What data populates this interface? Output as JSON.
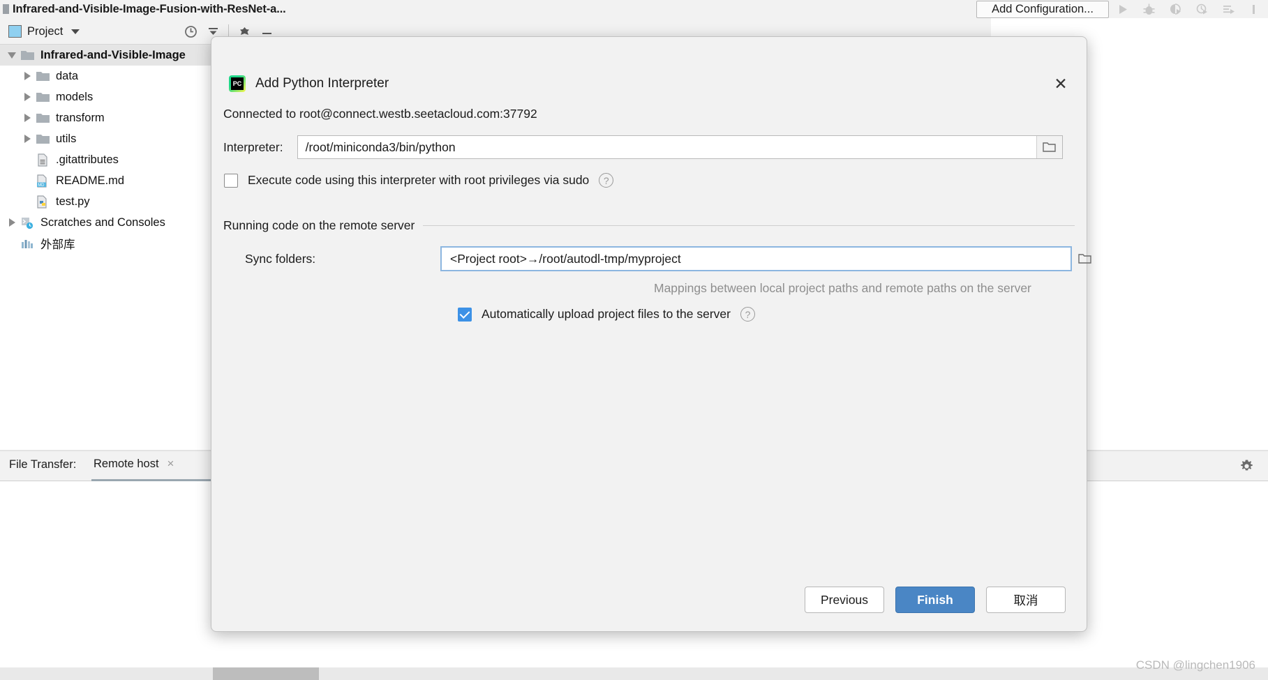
{
  "titlebar": {
    "project_title": "Infrared-and-Visible-Image-Fusion-with-ResNet-a...",
    "add_configuration_label": "Add Configuration...",
    "icons": [
      "run-icon",
      "debug-icon",
      "coverage-icon",
      "profile-icon",
      "services-icon"
    ]
  },
  "project_panel": {
    "header_label": "Project",
    "header_icons": [
      "locate-icon",
      "collapse-all-icon",
      "settings-icon",
      "hide-icon"
    ],
    "tree": [
      {
        "label": "Infrared-and-Visible-Image",
        "icon": "folder-icon",
        "arrow": "d",
        "selected": true,
        "indent": 1
      },
      {
        "label": "data",
        "icon": "folder-icon",
        "arrow": "r",
        "selected": false,
        "indent": 2
      },
      {
        "label": "models",
        "icon": "folder-icon",
        "arrow": "r",
        "selected": false,
        "indent": 2
      },
      {
        "label": "transform",
        "icon": "folder-icon",
        "arrow": "r",
        "selected": false,
        "indent": 2
      },
      {
        "label": "utils",
        "icon": "folder-icon",
        "arrow": "r",
        "selected": false,
        "indent": 2
      },
      {
        "label": ".gitattributes",
        "icon": "text-file-icon",
        "arrow": "none",
        "selected": false,
        "indent": 2
      },
      {
        "label": "README.md",
        "icon": "markdown-file-icon",
        "arrow": "none",
        "selected": false,
        "indent": 2
      },
      {
        "label": "test.py",
        "icon": "python-file-icon",
        "arrow": "none",
        "selected": false,
        "indent": 2
      },
      {
        "label": "Scratches and Consoles",
        "icon": "scratches-icon",
        "arrow": "r",
        "selected": false,
        "indent": 1
      },
      {
        "label": "外部库",
        "icon": "external-libraries-icon",
        "arrow": "none",
        "selected": false,
        "indent": 1
      }
    ]
  },
  "file_transfer": {
    "label": "File Transfer:",
    "tab_label": "Remote host",
    "close_glyph": "×",
    "gear_icon": "gear-icon"
  },
  "dialog": {
    "title": "Add Python Interpreter",
    "app_icon": "pycharm-icon",
    "close_glyph": "✕",
    "connection_status": "Connected to root@connect.westb.seetacloud.com:37792",
    "interpreter": {
      "label": "Interpreter:",
      "value": "/root/miniconda3/bin/python",
      "browse_icon": "folder-browse-icon"
    },
    "sudo_checkbox": {
      "label": "Execute code using this interpreter with root privileges via sudo",
      "checked": false,
      "help_glyph": "?"
    },
    "section_title": "Running code on the remote server",
    "sync_folders": {
      "label": "Sync folders:",
      "value": "<Project root>→/root/autodl-tmp/myproject",
      "browse_icon": "folder-browse-icon",
      "hint": "Mappings between local project paths and remote paths on the server"
    },
    "auto_upload_checkbox": {
      "label": "Automatically upload project files to the server",
      "checked": true,
      "help_glyph": "?"
    },
    "buttons": {
      "previous": "Previous",
      "finish": "Finish",
      "cancel": "取消"
    },
    "accent_color": "#4a86c5",
    "focus_border_color": "#8cb6e0"
  },
  "watermark": "CSDN @lingchen1906"
}
